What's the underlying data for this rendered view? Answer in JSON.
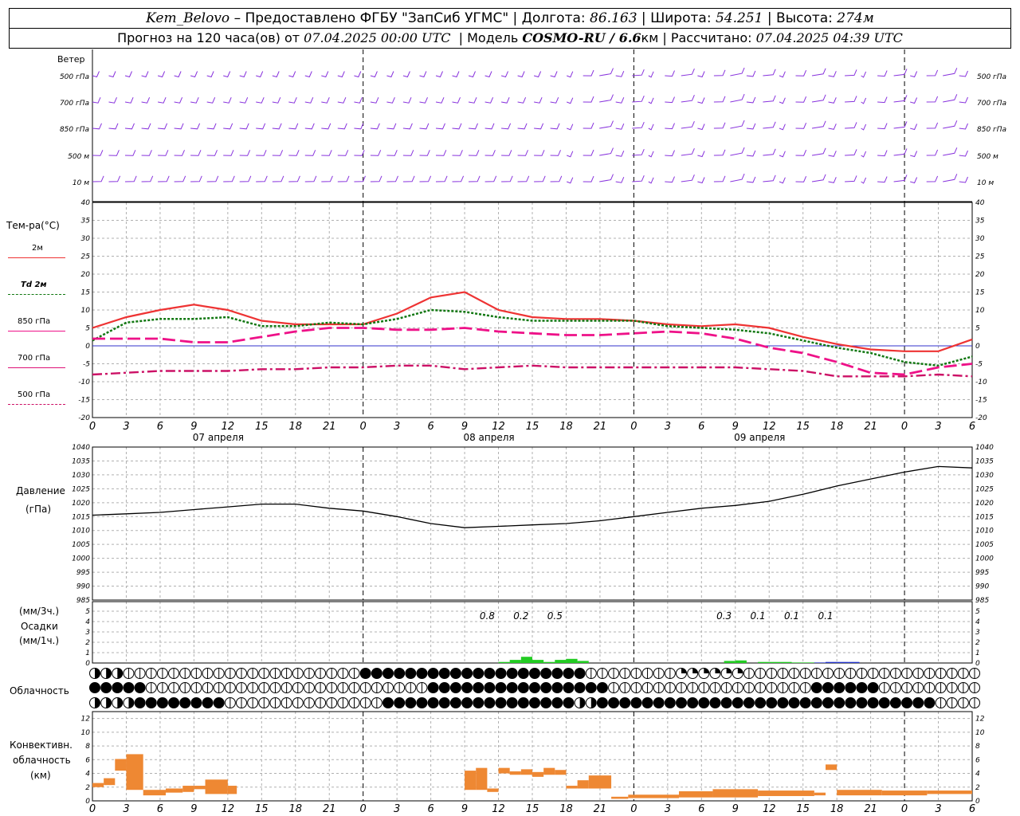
{
  "header": {
    "station": "Kem_Belovo",
    "provider": "– Предоставлено ФГБУ \"ЗапСиб УГМС\"",
    "lon_label": "Долгота:",
    "lon_value": "86.163",
    "lat_label": "Широта:",
    "lat_value": "54.251",
    "alt_label": "Высота:",
    "alt_value": "274м",
    "forecast_prefix": "Прогноз на 120 часа(ов) от",
    "forecast_start": "07.04.2025 00:00 UTC",
    "model_label": "Модель",
    "model_value": "COSMO-RU / 6.6",
    "model_unit": "км",
    "calc_label": "Рассчитано:",
    "calc_value": "07.04.2025 04:39 UTC"
  },
  "colors": {
    "t2m": "#ee3333",
    "td2m": "#117711",
    "t850": "#ee1188",
    "t700": "#dd1177",
    "t500": "#cc1166",
    "zero_line": "#3333cc",
    "wind": "#8833dd",
    "precip_green": "#22cc22",
    "precip_blue": "#2233cc",
    "convective": "#ee8833",
    "grid": "#b0b0b0"
  },
  "wind_panel": {
    "title": "Ветер",
    "levels": [
      "500 гПа",
      "700 гПа",
      "850 гПа",
      "500 м",
      "10 м"
    ],
    "icon": "wind-barb-icon"
  },
  "temp_panel": {
    "title": "Тем-ра(°C)",
    "legend": [
      "2м",
      "Td 2м",
      "850 гПа",
      "700 гПа",
      "500 гПа"
    ],
    "yticks": [
      40,
      35,
      30,
      25,
      20,
      15,
      10,
      5,
      0,
      -5,
      -10,
      -15,
      -20
    ]
  },
  "time_axis": {
    "hour_labels": [
      "0",
      "3",
      "6",
      "9",
      "12",
      "15",
      "18",
      "21",
      "0",
      "3",
      "6",
      "9",
      "12",
      "15",
      "18",
      "21",
      "0",
      "3",
      "6",
      "9",
      "12",
      "15",
      "18",
      "21",
      "0",
      "3",
      "6"
    ],
    "day_labels": [
      "07 апреля",
      "08 апреля",
      "09 апреля"
    ]
  },
  "pressure_panel": {
    "title": "Давление",
    "unit": "(гПа)",
    "yticks": [
      1040,
      1035,
      1030,
      1025,
      1020,
      1015,
      1010,
      1005,
      1000,
      995,
      990,
      985
    ]
  },
  "precip_panel": {
    "unit3": "(мм/3ч.)",
    "title": "Осадки",
    "unit1": "(мм/1ч.)",
    "yticks": [
      5,
      4,
      3,
      2,
      1,
      0
    ],
    "totals": [
      {
        "hour": 35,
        "text": "0.8"
      },
      {
        "hour": 38,
        "text": "0.2"
      },
      {
        "hour": 41,
        "text": "0.5"
      },
      {
        "hour": 56,
        "text": "0.3"
      },
      {
        "hour": 59,
        "text": "0.1"
      },
      {
        "hour": 62,
        "text": "0.1"
      },
      {
        "hour": 65,
        "text": "0.1"
      }
    ]
  },
  "cloud_panel": {
    "title": "Облачность",
    "icon": "cloud-cover-icon"
  },
  "conv_panel": {
    "title_line1": "Конвективн.",
    "title_line2": "облачность",
    "unit": "(км)",
    "yticks": [
      12,
      10,
      8,
      6,
      4,
      2,
      0
    ]
  },
  "chart_data": [
    {
      "type": "line",
      "id": "temperature",
      "ylabel": "Тем-ра(°C)",
      "ylim": [
        -20,
        40
      ],
      "x_hours": [
        0,
        3,
        6,
        9,
        12,
        15,
        18,
        21,
        24,
        27,
        30,
        33,
        36,
        39,
        42,
        45,
        48,
        51,
        54,
        57,
        60,
        63,
        66,
        69,
        72,
        75,
        78
      ],
      "series": [
        {
          "name": "2м",
          "style": "solid",
          "values": [
            5,
            8,
            10,
            11.5,
            10,
            7,
            6,
            6,
            6,
            9,
            13.5,
            15,
            10,
            8,
            7.5,
            7.5,
            7,
            6,
            5.5,
            6,
            5,
            2.5,
            0.5,
            -1,
            -1.5,
            -1.5,
            1.8
          ]
        },
        {
          "name": "Td 2м",
          "style": "dotted",
          "values": [
            1.5,
            6.5,
            7.5,
            7.5,
            8,
            5.5,
            5.5,
            6.5,
            6,
            7.5,
            10,
            9.5,
            8,
            7,
            7,
            7,
            7,
            5.5,
            5,
            4.5,
            3.5,
            1.5,
            -0.5,
            -2,
            -4.5,
            -5.5,
            -3
          ]
        },
        {
          "name": "850 гПа",
          "style": "dashed",
          "values": [
            2,
            2,
            2,
            1,
            1,
            2.5,
            4,
            5,
            5,
            4.5,
            4.5,
            5,
            4,
            3.5,
            3,
            3,
            3.5,
            4,
            3.5,
            2,
            -0.5,
            -2,
            -4.5,
            -7.5,
            -8,
            -6,
            -5
          ]
        },
        {
          "name": "700 гПа",
          "style": "dashed",
          "values": [
            2,
            2,
            2,
            1,
            1,
            2.5,
            4,
            5,
            5,
            4.5,
            4.5,
            5,
            4,
            3.5,
            3,
            3,
            3.5,
            4,
            3.5,
            2,
            -0.5,
            -2,
            -4.5,
            -7.5,
            -8,
            -6,
            -5
          ]
        },
        {
          "name": "500 гПа",
          "style": "dashdot",
          "values": [
            -8,
            -7.5,
            -7,
            -7,
            -7,
            -6.5,
            -6.5,
            -6,
            -6,
            -5.5,
            -5.5,
            -6.5,
            -6,
            -5.5,
            -6,
            -6,
            -6,
            -6,
            -6,
            -6,
            -6.5,
            -7,
            -8.5,
            -8.5,
            -8.5,
            -8,
            -8.5
          ]
        }
      ]
    },
    {
      "type": "line",
      "id": "pressure",
      "ylabel": "Давление",
      "ylim": [
        985,
        1040
      ],
      "x_hours": [
        0,
        3,
        6,
        9,
        12,
        15,
        18,
        21,
        24,
        27,
        30,
        33,
        36,
        39,
        42,
        45,
        48,
        51,
        54,
        57,
        60,
        63,
        66,
        69,
        72,
        75,
        78
      ],
      "series": [
        {
          "name": "",
          "values": [
            1015.5,
            1016,
            1016.5,
            1017.5,
            1018.5,
            1019.5,
            1019.5,
            1018,
            1017,
            1015,
            1012.5,
            1011,
            1011.5,
            1012,
            1012.5,
            1013.5,
            1015,
            1016.5,
            1018,
            1019,
            1020.5,
            1023,
            1026,
            1028.5,
            1031,
            1033,
            1032.5
          ]
        }
      ]
    },
    {
      "type": "bar",
      "id": "precipitation",
      "ylabel": "Осадки",
      "ylim": [
        0,
        5
      ],
      "x_hours": [
        36,
        37,
        38,
        39,
        40,
        41,
        42,
        43,
        56,
        57,
        59,
        60,
        61,
        62,
        63,
        64,
        65,
        66,
        67
      ],
      "series": [
        {
          "name": "",
          "color": "green",
          "values": [
            0.1,
            0.3,
            0.6,
            0.3,
            0.1,
            0.3,
            0.4,
            0.2,
            0.2,
            0.25,
            0.1,
            0.1,
            0.1,
            0.05,
            0.05,
            0.05,
            0.1,
            0.1,
            0.1
          ]
        }
      ]
    },
    {
      "type": "bar",
      "id": "convective_cloud",
      "ylabel": "Конвективн. облачность",
      "ylim": [
        0,
        13
      ],
      "bars": [
        {
          "h0": 0,
          "h1": 1,
          "lo": 2,
          "hi": 2.6
        },
        {
          "h0": 1,
          "h1": 2,
          "lo": 2.3,
          "hi": 3.3
        },
        {
          "h0": 2,
          "h1": 3,
          "lo": 4.4,
          "hi": 6.1
        },
        {
          "h0": 3,
          "h1": 4.5,
          "lo": 1.6,
          "hi": 6.8
        },
        {
          "h0": 4.5,
          "h1": 6.5,
          "lo": 0.8,
          "hi": 1.6
        },
        {
          "h0": 6.5,
          "h1": 8,
          "lo": 1.2,
          "hi": 1.8
        },
        {
          "h0": 8,
          "h1": 9,
          "lo": 1.3,
          "hi": 2.2
        },
        {
          "h0": 9,
          "h1": 10,
          "lo": 1.7,
          "hi": 2.2
        },
        {
          "h0": 10,
          "h1": 12,
          "lo": 1.0,
          "hi": 3.1
        },
        {
          "h0": 12,
          "h1": 12.8,
          "lo": 1.0,
          "hi": 2.2
        },
        {
          "h0": 33,
          "h1": 34,
          "lo": 1.6,
          "hi": 4.4
        },
        {
          "h0": 34,
          "h1": 35,
          "lo": 1.6,
          "hi": 4.8
        },
        {
          "h0": 35,
          "h1": 36,
          "lo": 1.3,
          "hi": 1.8
        },
        {
          "h0": 36,
          "h1": 37,
          "lo": 4.0,
          "hi": 4.8
        },
        {
          "h0": 37,
          "h1": 38,
          "lo": 3.8,
          "hi": 4.3
        },
        {
          "h0": 38,
          "h1": 39,
          "lo": 3.8,
          "hi": 4.6
        },
        {
          "h0": 39,
          "h1": 40,
          "lo": 3.5,
          "hi": 4.2
        },
        {
          "h0": 40,
          "h1": 41,
          "lo": 3.8,
          "hi": 4.8
        },
        {
          "h0": 41,
          "h1": 42,
          "lo": 3.8,
          "hi": 4.5
        },
        {
          "h0": 42,
          "h1": 43,
          "lo": 1.8,
          "hi": 2.2
        },
        {
          "h0": 43,
          "h1": 44,
          "lo": 1.8,
          "hi": 3.0
        },
        {
          "h0": 44,
          "h1": 46,
          "lo": 1.8,
          "hi": 3.7
        },
        {
          "h0": 46,
          "h1": 47.5,
          "lo": 0.3,
          "hi": 0.6
        },
        {
          "h0": 47.5,
          "h1": 52,
          "lo": 0.4,
          "hi": 0.9
        },
        {
          "h0": 52,
          "h1": 55,
          "lo": 0.5,
          "hi": 1.4
        },
        {
          "h0": 55,
          "h1": 59,
          "lo": 0.5,
          "hi": 1.7
        },
        {
          "h0": 59,
          "h1": 64,
          "lo": 0.7,
          "hi": 1.5
        },
        {
          "h0": 64,
          "h1": 65,
          "lo": 0.8,
          "hi": 1.2
        },
        {
          "h0": 65,
          "h1": 66,
          "lo": 4.5,
          "hi": 5.3
        },
        {
          "h0": 66,
          "h1": 70,
          "lo": 0.8,
          "hi": 1.6
        },
        {
          "h0": 70,
          "h1": 74,
          "lo": 0.8,
          "hi": 1.5
        },
        {
          "h0": 74,
          "h1": 78,
          "lo": 1.0,
          "hi": 1.5
        }
      ]
    }
  ]
}
